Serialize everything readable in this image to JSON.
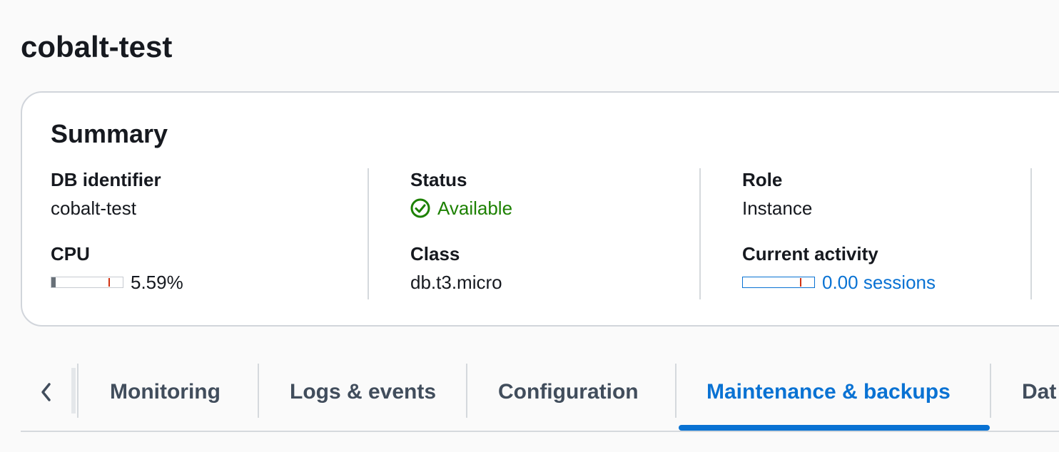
{
  "page": {
    "title": "cobalt-test"
  },
  "summary": {
    "title": "Summary",
    "db_identifier": {
      "label": "DB identifier",
      "value": "cobalt-test"
    },
    "status": {
      "label": "Status",
      "value": "Available",
      "icon": "check-circle-icon",
      "color": "#1d8102"
    },
    "role": {
      "label": "Role",
      "value": "Instance"
    },
    "cpu": {
      "label": "CPU",
      "value": "5.59%",
      "percent": 5.59,
      "threshold_percent": 80
    },
    "db_class": {
      "label": "Class",
      "value": "db.t3.micro"
    },
    "current_activity": {
      "label": "Current activity",
      "value": "0.00 sessions",
      "fraction": 0.0,
      "threshold_fraction": 0.8,
      "color": "#0972d3"
    }
  },
  "tabs": {
    "scroll_left_icon": "chevron-left-icon",
    "items": [
      {
        "label": "Monitoring",
        "active": false
      },
      {
        "label": "Logs & events",
        "active": false
      },
      {
        "label": "Configuration",
        "active": false
      },
      {
        "label": "Maintenance & backups",
        "active": true
      },
      {
        "label": "Dat",
        "active": false
      }
    ],
    "active_color": "#0972d3"
  }
}
